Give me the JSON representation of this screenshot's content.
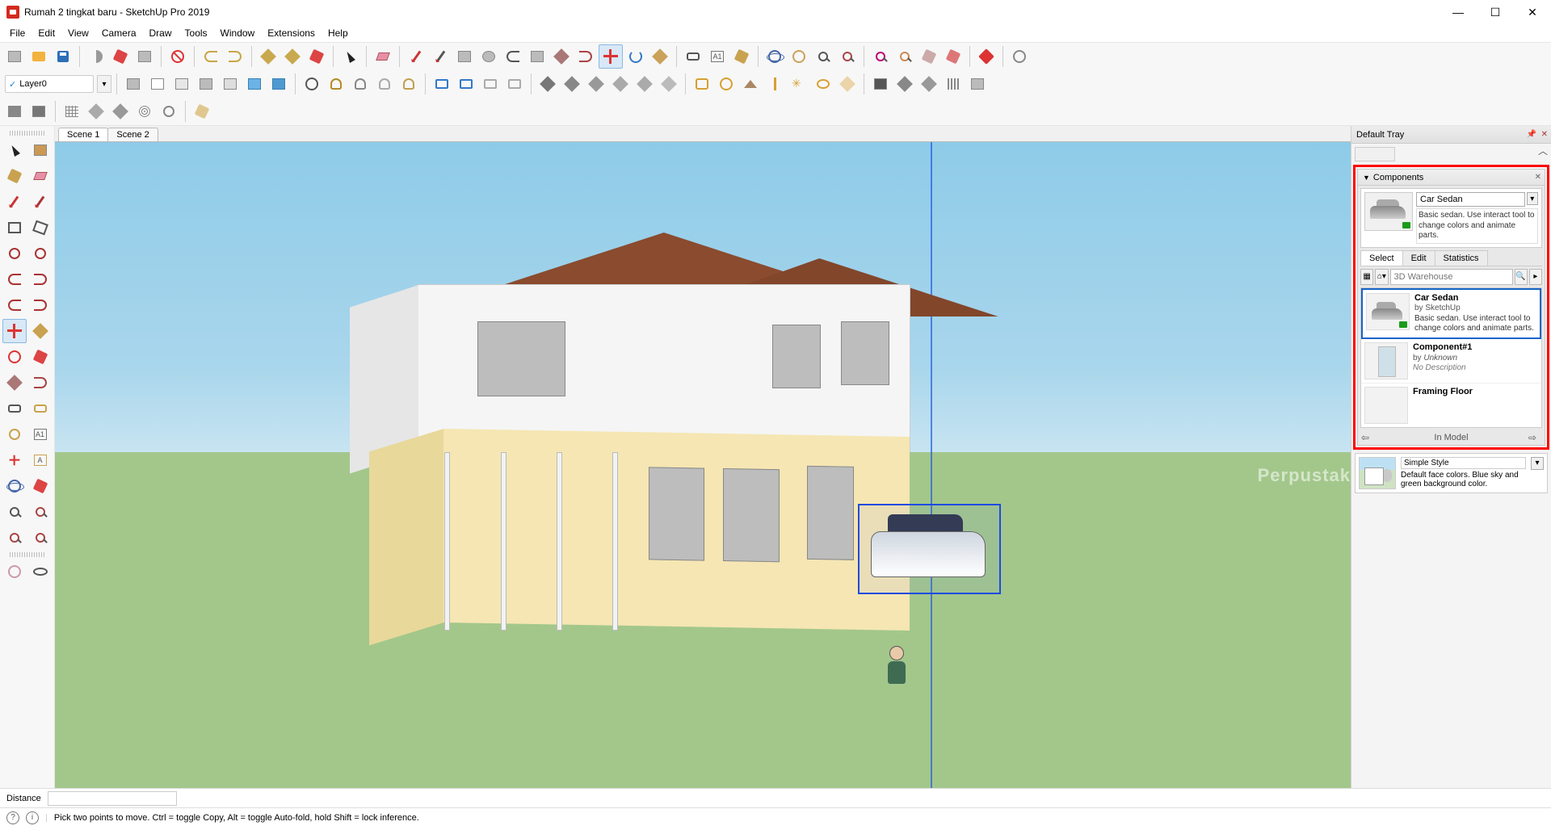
{
  "titlebar": {
    "title": "Rumah 2 tingkat baru - SketchUp Pro 2019",
    "min": "—",
    "max": "☐",
    "close": "✕"
  },
  "menu": [
    "File",
    "Edit",
    "View",
    "Camera",
    "Draw",
    "Tools",
    "Window",
    "Extensions",
    "Help"
  ],
  "layer": {
    "current": "Layer0",
    "check": "✓"
  },
  "scenes": [
    "Scene 1",
    "Scene 2"
  ],
  "active_scene": 0,
  "watermark": "Perpustak",
  "tray": {
    "title": "Default Tray",
    "components": {
      "header": "Components",
      "selected_name": "Car Sedan",
      "selected_desc": "Basic sedan.  Use interact tool to change colors and animate parts.",
      "tabs": [
        "Select",
        "Edit",
        "Statistics"
      ],
      "active_tab": 0,
      "search_placeholder": "3D Warehouse",
      "list": [
        {
          "name": "Car Sedan",
          "by": "SketchUp",
          "desc": "Basic sedan.  Use interact tool to change colors and animate parts.",
          "thumb": "car",
          "selected": true
        },
        {
          "name": "Component#1",
          "by": "Unknown",
          "desc": "No Description",
          "thumb": "rect",
          "selected": false
        },
        {
          "name": "Framing Floor",
          "by": "",
          "desc": "",
          "thumb": "rect",
          "selected": false
        }
      ],
      "nav_label": "In Model",
      "nav_prev": "⇦",
      "nav_next": "⇨"
    },
    "style": {
      "name": "Simple Style",
      "desc": "Default face colors. Blue sky and green background color."
    }
  },
  "dimension_label": "Distance",
  "statusbar": {
    "hint": "Pick two points to move.  Ctrl = toggle Copy, Alt = toggle Auto-fold, hold Shift = lock inference."
  },
  "toolbar_icons_row1": [
    "new-icon",
    "open-icon",
    "save-icon",
    "cut-icon",
    "copy-icon",
    "paste-icon",
    "erase-icon",
    "undo-icon",
    "redo-icon",
    "print-icon",
    "model-icon",
    "warehouse-icon",
    "select-icon",
    "eraser-icon",
    "line-icon",
    "draw-icon",
    "rect-icon",
    "circle-icon",
    "arc-icon",
    "poly-icon",
    "pushpull-icon",
    "offset-icon",
    "move-icon",
    "rotate-icon",
    "scale-icon",
    "tape-icon",
    "text-icon",
    "paint-icon",
    "orbit-icon",
    "pan-icon",
    "zoom-icon",
    "zoomext-icon",
    "prev-icon",
    "next-icon",
    "iso-icon",
    "top-icon",
    "front-icon",
    "gems-icon",
    "user-icon"
  ],
  "toolbar_icons_row2": [
    "layer-check",
    "face-icon",
    "face2-icon",
    "face3-icon",
    "face4-icon",
    "face5-icon",
    "face6-icon",
    "face7-icon",
    "section-icon",
    "section2-icon",
    "section3-icon",
    "section4-icon",
    "view-icon",
    "view2-icon",
    "view3-icon",
    "view4-icon",
    "solid1-icon",
    "solid2-icon",
    "solid3-icon",
    "solid4-icon",
    "solid5-icon",
    "solid6-icon",
    "sun1-icon",
    "sun2-icon",
    "sun3-icon",
    "sun4-icon",
    "sun5-icon",
    "sun6-icon",
    "sun7-icon",
    "cam-icon",
    "cam2-icon",
    "cam3-icon",
    "cam4-icon",
    "cam5-icon"
  ],
  "toolbar_icons_row3": [
    "sand1-icon",
    "sand2-icon",
    "sand3-icon",
    "sand4-icon",
    "sand5-icon",
    "sand6-icon",
    "sand7-icon",
    "sand8-icon"
  ],
  "left_tools": [
    [
      "select-tool",
      "lasso-tool"
    ],
    [
      "paint-tool",
      "eraser-tool"
    ],
    [
      "line-tool",
      "freehand-tool"
    ],
    [
      "rect-tool",
      "rotrect-tool"
    ],
    [
      "circle-tool",
      "poly-tool"
    ],
    [
      "arc-tool",
      "arc2-tool"
    ],
    [
      "arc3-tool",
      "pie-tool"
    ],
    [
      "move-tool",
      "pushpull-tool"
    ],
    [
      "rotate-tool",
      "followme-tool"
    ],
    [
      "scale-tool",
      "offset-tool"
    ],
    [
      "tape-tool",
      "dim-tool"
    ],
    [
      "protractor-tool",
      "text-tool"
    ],
    [
      "axes-tool",
      "3dtext-tool"
    ],
    [
      "orbit-tool",
      "pan-tool"
    ],
    [
      "zoom-tool",
      "zoomwin-tool"
    ],
    [
      "prev-tool",
      "next-tool"
    ],
    [
      "camera-tool",
      "walk-tool"
    ],
    [
      "look-tool",
      "section-tool"
    ]
  ],
  "move_tool_selected": true,
  "colors": {
    "select_blue": "#1f5be0",
    "highlight_red": "#ff0000"
  }
}
